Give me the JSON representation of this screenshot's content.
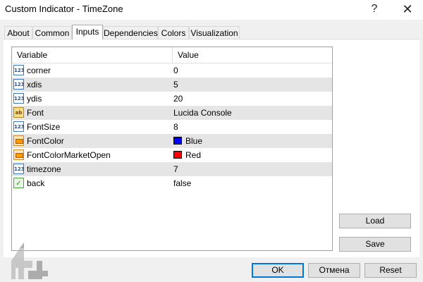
{
  "window": {
    "title": "Custom Indicator - TimeZone",
    "help_glyph": "?",
    "close_glyph": "✕"
  },
  "tabs": [
    {
      "label": "About",
      "active": false
    },
    {
      "label": "Common",
      "active": false
    },
    {
      "label": "Inputs",
      "active": true
    },
    {
      "label": "Dependencies",
      "active": false
    },
    {
      "label": "Colors",
      "active": false
    },
    {
      "label": "Visualization",
      "active": false
    }
  ],
  "grid": {
    "headers": {
      "variable": "Variable",
      "value": "Value"
    },
    "rows": [
      {
        "icon": "integer-icon",
        "name": "corner",
        "value": "0"
      },
      {
        "icon": "integer-icon",
        "name": "xdis",
        "value": "5"
      },
      {
        "icon": "integer-icon",
        "name": "ydis",
        "value": "20"
      },
      {
        "icon": "string-icon",
        "name": "Font",
        "value": "Lucida Console"
      },
      {
        "icon": "integer-icon",
        "name": "FontSize",
        "value": "8"
      },
      {
        "icon": "color-icon",
        "name": "FontColor",
        "value": "Blue",
        "swatch": "#0000ff"
      },
      {
        "icon": "color-icon",
        "name": "FontColorMarketOpen",
        "value": "Red",
        "swatch": "#ff0000"
      },
      {
        "icon": "integer-icon",
        "name": "timezone",
        "value": "7"
      },
      {
        "icon": "bool-icon",
        "name": "back",
        "value": "false"
      }
    ]
  },
  "icons": {
    "integer-icon": "123",
    "string-icon": "ab",
    "bool-icon": "✓"
  },
  "side_buttons": {
    "load": "Load",
    "save": "Save"
  },
  "footer_buttons": {
    "ok": "OK",
    "cancel": "Отмена",
    "reset": "Reset"
  },
  "colors": {
    "accent": "#0078d7",
    "alt_row": "#e5e5e5"
  }
}
